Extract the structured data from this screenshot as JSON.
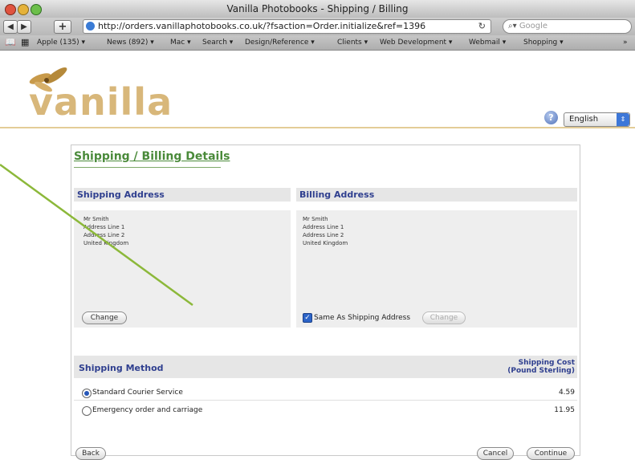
{
  "window": {
    "title": "Vanilla Photobooks - Shipping / Billing"
  },
  "toolbar": {
    "url": "http://orders.vanillaphotobooks.co.uk/?fsaction=Order.initialize&ref=1396",
    "search_placeholder": "Google",
    "bookmarks": [
      "Apple (135) ▾",
      "News (892) ▾",
      "Mac ▾",
      "Search ▾",
      "Design/Reference ▾",
      "Clients ▾",
      "Web Development ▾",
      "Webmail ▾",
      "Shopping ▾"
    ],
    "overflow": "»"
  },
  "site": {
    "logo_text": "vanilla",
    "language": "English"
  },
  "page": {
    "title": "Shipping / Billing Details",
    "shipping_address": {
      "heading": "Shipping Address",
      "lines": [
        "Mr Smith",
        "Address Line 1",
        "Address Line 2",
        "United Kingdom"
      ],
      "change_label": "Change"
    },
    "billing_address": {
      "heading": "Billing Address",
      "lines": [
        "Mr Smith",
        "Address Line 1",
        "Address Line 2",
        "United Kingdom"
      ],
      "same_as_shipping_label": "Same As Shipping Address",
      "same_as_shipping_checked": true,
      "change_label": "Change"
    },
    "shipping_method": {
      "heading": "Shipping Method",
      "cost_heading_line1": "Shipping Cost",
      "cost_heading_line2": "(Pound Sterling)",
      "options": [
        {
          "label": "Standard Courier Service",
          "cost": "4.59",
          "selected": true
        },
        {
          "label": "Emergency order and carriage",
          "cost": "11.95",
          "selected": false
        }
      ]
    },
    "buttons": {
      "back": "Back",
      "cancel": "Cancel",
      "continue": "Continue"
    }
  },
  "colors": {
    "accent_green": "#8cb83a",
    "heading_blue": "#2f3f8f",
    "logo_gold": "#d8b77a"
  }
}
